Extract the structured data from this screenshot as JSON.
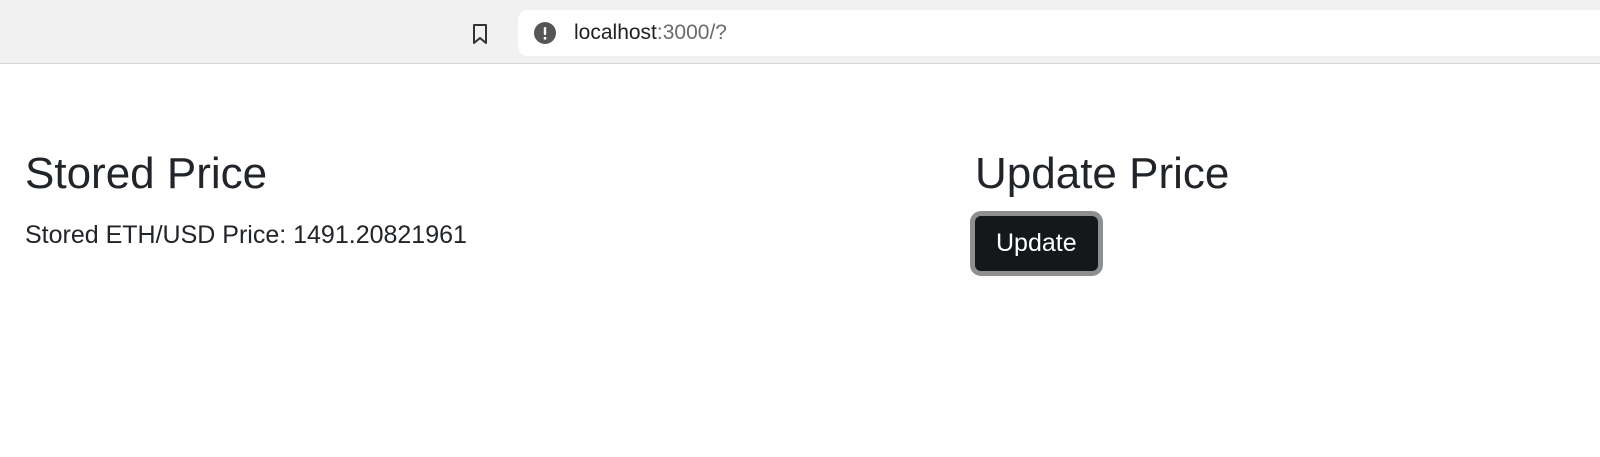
{
  "browser": {
    "url_host": "localhost",
    "url_rest": ":3000/?"
  },
  "stored": {
    "heading": "Stored Price",
    "label": "Stored ETH/USD Price: 1491.20821961"
  },
  "update": {
    "heading": "Update Price",
    "button_label": "Update"
  },
  "icons": {
    "bookmark": "bookmark-icon",
    "info": "info-icon"
  }
}
